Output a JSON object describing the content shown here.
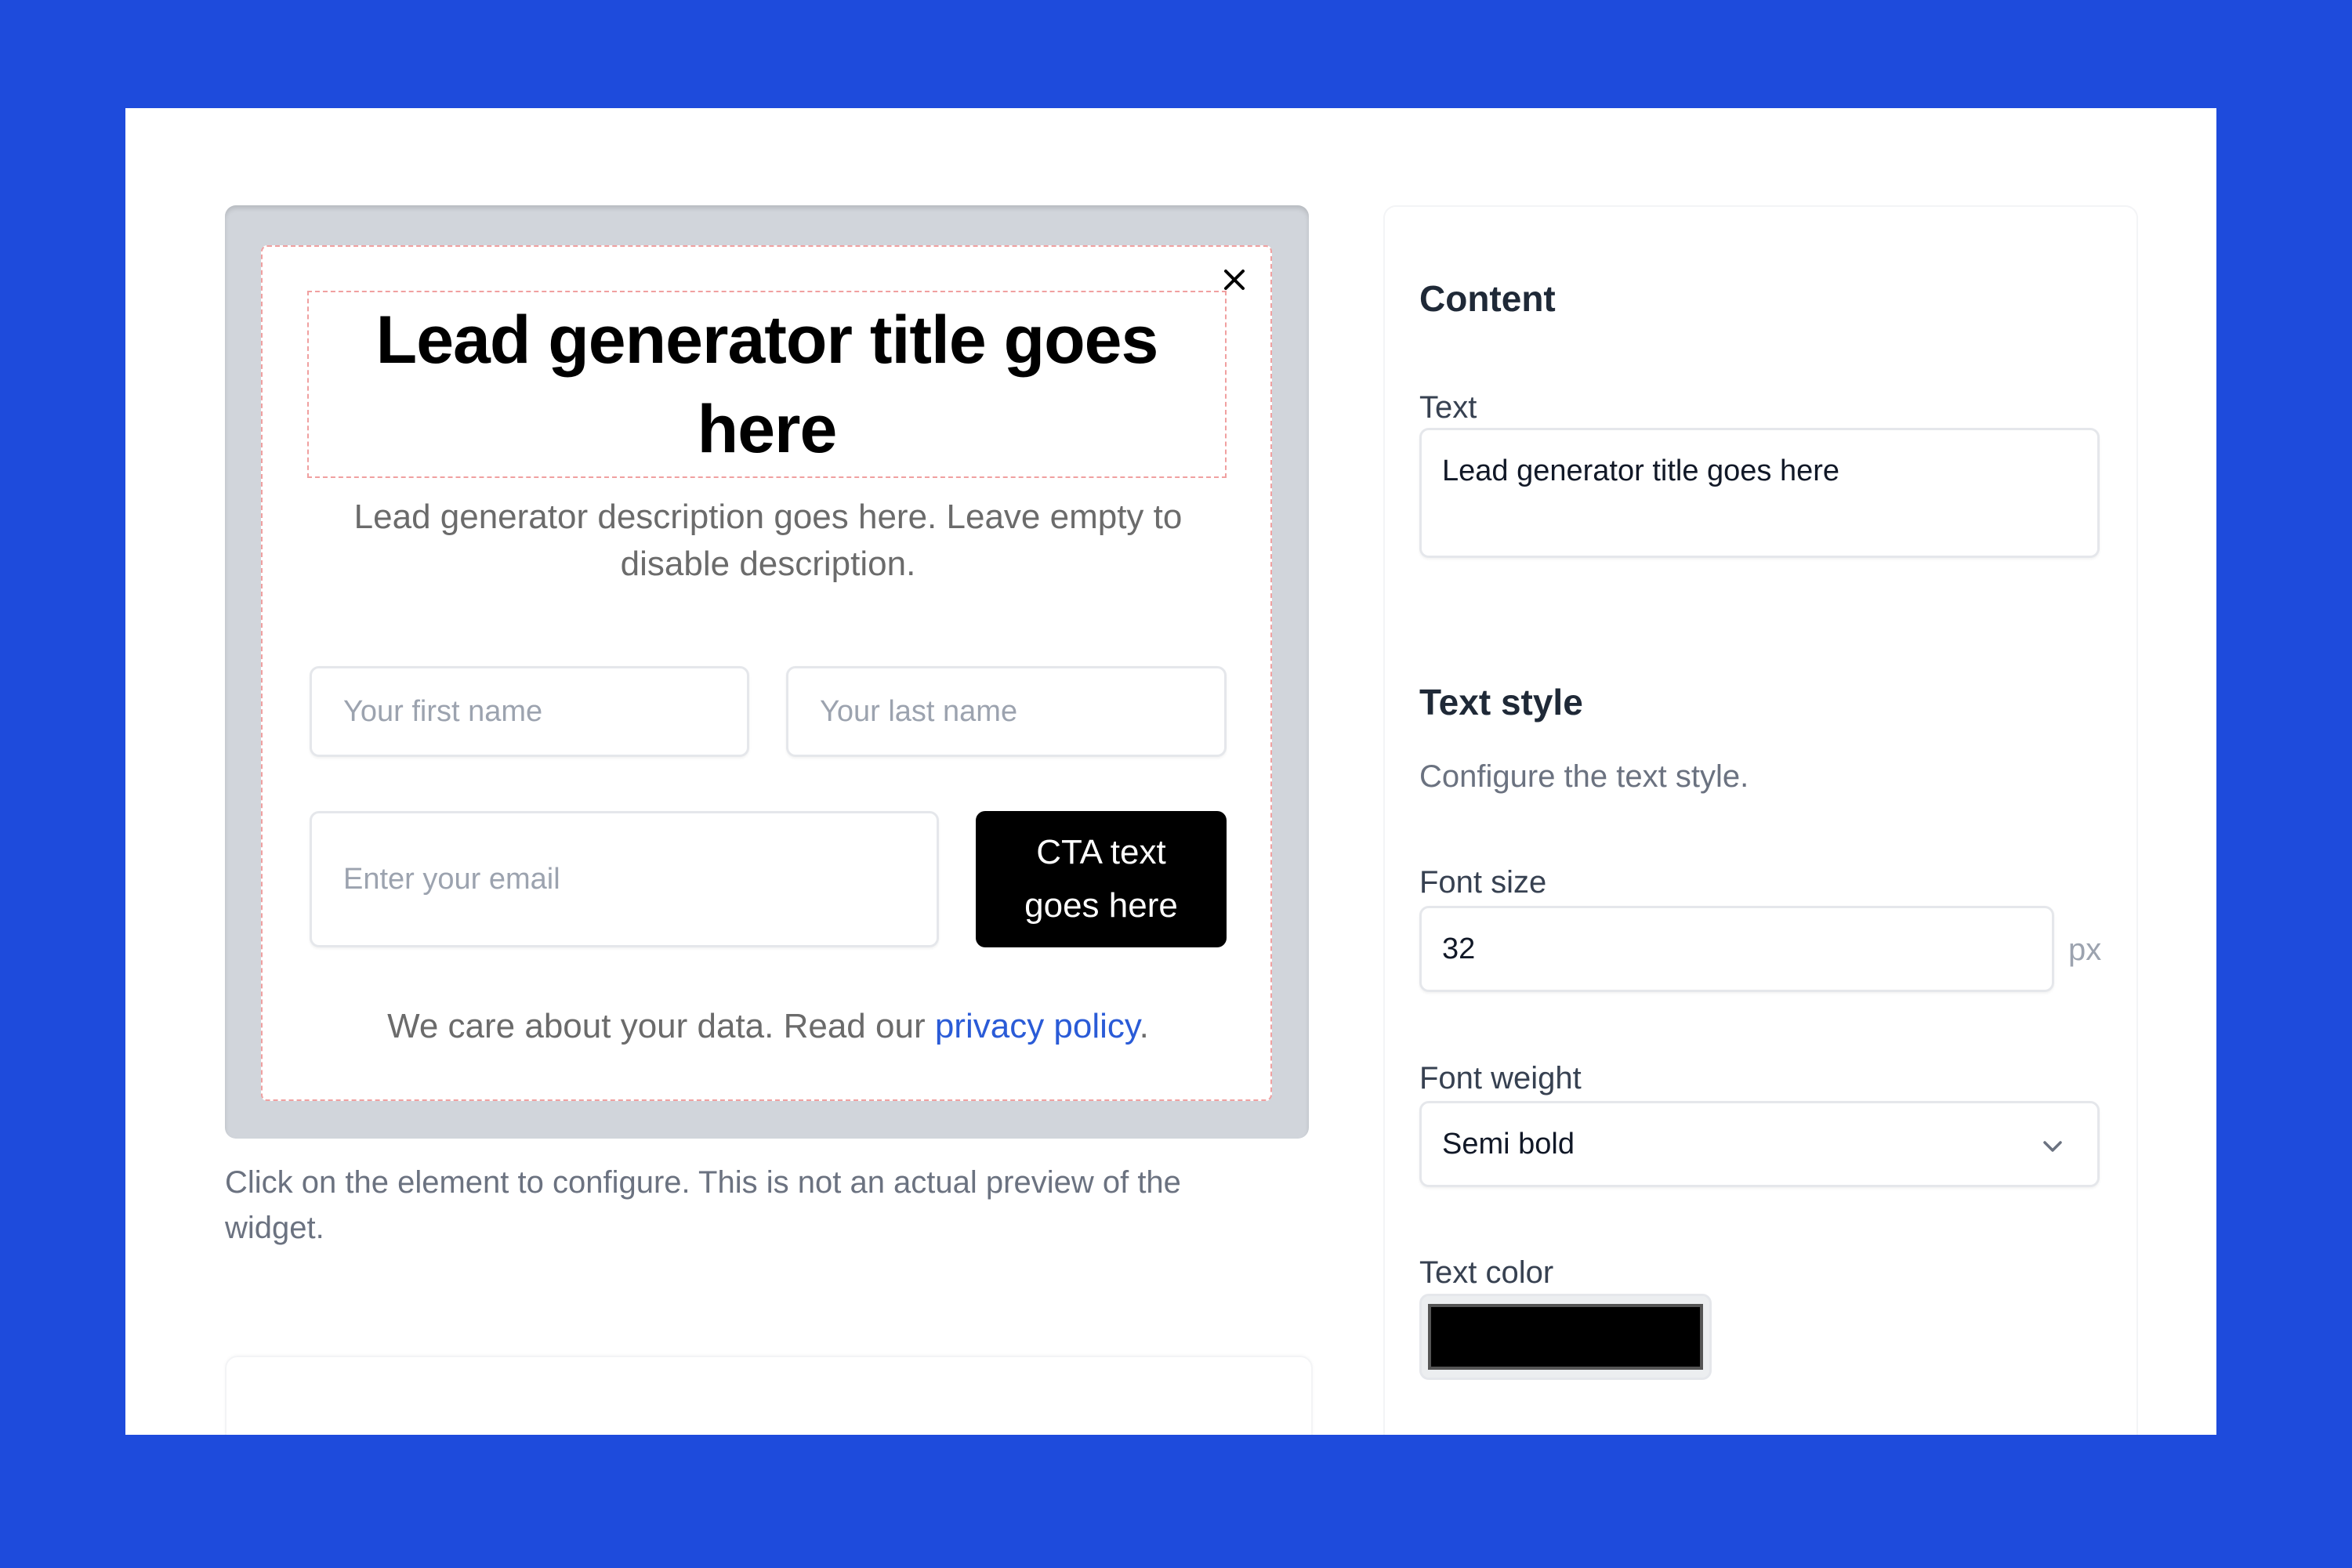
{
  "preview": {
    "title": "Lead generator title goes here",
    "description": "Lead generator description goes here. Leave empty to disable description.",
    "first_name_placeholder": "Your first name",
    "last_name_placeholder": "Your last name",
    "email_placeholder": "Enter your email",
    "cta_label": "CTA text goes here",
    "privacy_prefix": "We care about your data. Read our ",
    "privacy_link": "privacy policy",
    "privacy_suffix": ".",
    "close_icon": "close-icon"
  },
  "helper_text": "Click on the element to configure. This is not an actual preview of the widget.",
  "settings": {
    "content": {
      "title": "Content",
      "text_label": "Text",
      "text_value": "Lead generator title goes here"
    },
    "text_style": {
      "title": "Text style",
      "subtitle": "Configure the text style.",
      "font_size_label": "Font size",
      "font_size_value": "32",
      "font_size_unit": "px",
      "font_weight_label": "Font weight",
      "font_weight_value": "Semi bold",
      "text_color_label": "Text color",
      "text_color_value": "#000000"
    }
  },
  "colors": {
    "background": "#1e4bdc",
    "link": "#2a5bd7",
    "cta": "#000000",
    "selection_outline": "#f0a0a0"
  }
}
